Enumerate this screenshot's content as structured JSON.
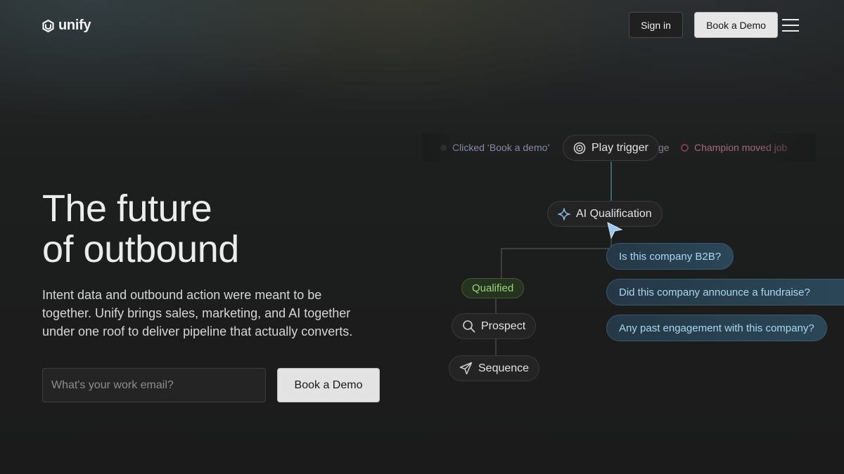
{
  "header": {
    "brand": "unify",
    "signin_label": "Sign in",
    "book_demo_label": "Book a Demo",
    "menu_icon": "hamburger-menu-icon"
  },
  "hero": {
    "title_line1": "The future",
    "title_line2": "of outbound",
    "subtitle": "Intent data and outbound action were meant to be together. Unify brings sales, marketing, and AI together under one roof to deliver pipeline that actually converts.",
    "email_placeholder": "What's your work email?",
    "email_value": "",
    "cta_label": "Book a Demo"
  },
  "workflow": {
    "ticker": [
      {
        "text": "Clicked ‘Book a demo’",
        "color": "#8f86a8",
        "dot": "#3e3e3e"
      },
      {
        "text": "ge",
        "color": "#8a7d8a",
        "dot": null
      },
      {
        "text": "Champion moved job",
        "color": "#a56a7b",
        "dot": "#7a3d4c"
      }
    ],
    "trigger": {
      "label": "Play trigger",
      "icon": "target-icon"
    },
    "qualification": {
      "label": "AI Qualification",
      "icon": "sparkle-icon"
    },
    "questions": [
      "Is this company B2B?",
      "Did this company announce a fundraise?",
      "Any past engagement with this company?"
    ],
    "qualified_label": "Qualified",
    "prospect": {
      "label": "Prospect",
      "icon": "search-icon"
    },
    "sequence": {
      "label": "Sequence",
      "icon": "send-icon"
    }
  },
  "colors": {
    "background": "#1b1b1b",
    "qualified_text": "#98d77f",
    "question_text": "#a9d7f0",
    "cursor": "#9ec8ee"
  }
}
